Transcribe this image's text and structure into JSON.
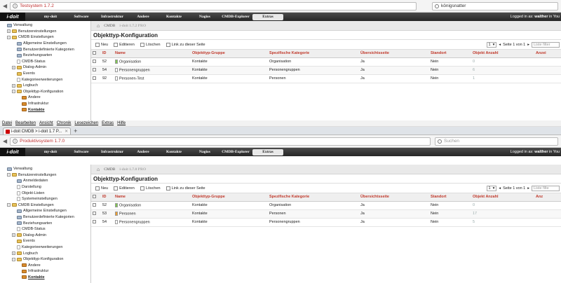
{
  "window1": {
    "url_title": "Testsystem 1.7.2",
    "search_value": "königsnatter",
    "logo": "i-doit",
    "nav": [
      "my-doit",
      "Software",
      "Infrastruktur",
      "Andere",
      "Kontakte",
      "Nagios",
      "CMDB-Explorer",
      "Extras"
    ],
    "logged_in": "Logged in as: ",
    "user": "walther",
    "user_suffix": " in You",
    "breadcrumb": [
      "CMDB",
      "i-doit 1.7.2 PRO"
    ],
    "page_title": "Objekttyp-Konfiguration",
    "toolbar": [
      "Neu",
      "Editieren",
      "Löschen",
      "Link zu dieser Seite"
    ],
    "pager": {
      "page_select": "1",
      "page_text": "Seite 1 von 1",
      "filter_placeholder": "Liste filter"
    },
    "columns": [
      "ID",
      "Name",
      "Objekttyp-Gruppe",
      "Spezifische Kategorie",
      "Übersichtsseite",
      "Standort",
      "Objekt Anzahl",
      "Anzei"
    ],
    "rows": [
      {
        "id": "52",
        "name": "Organisation",
        "color": "#7ec850",
        "group": "Kontakte",
        "cat": "Organisation",
        "overview": "Ja",
        "loc": "Nein",
        "count": "0"
      },
      {
        "id": "54",
        "name": "Personengruppen",
        "color": "#ffffff",
        "group": "Kontakte",
        "cat": "Personengruppen",
        "overview": "Ja",
        "loc": "Nein",
        "count": "6"
      },
      {
        "id": "92",
        "name": "Personen-Test",
        "color": "#ffffff",
        "group": "Kontakte",
        "cat": "Personen",
        "overview": "Ja",
        "loc": "Nein",
        "count": "1"
      }
    ],
    "tree": [
      {
        "label": "Verwaltung",
        "lvl": 0,
        "tog": "",
        "icon": "f-g"
      },
      {
        "label": "Benutzereinstellungen",
        "lvl": 1,
        "tog": "+",
        "icon": "f-y"
      },
      {
        "label": "CMDB Einstellungen",
        "lvl": 1,
        "tog": "−",
        "icon": "f-y"
      },
      {
        "label": "Allgemeine Einstellungen",
        "lvl": 2,
        "tog": "",
        "icon": "f-g"
      },
      {
        "label": "Benutzerdefinierte Kategorien",
        "lvl": 2,
        "tog": "",
        "icon": "f-g"
      },
      {
        "label": "Beziehungsarten",
        "lvl": 2,
        "tog": "",
        "icon": "f-g"
      },
      {
        "label": "CMDB-Status",
        "lvl": 2,
        "tog": "",
        "icon": "f-p"
      },
      {
        "label": "Dialog-Admin",
        "lvl": 2,
        "tog": "+",
        "icon": "f-y"
      },
      {
        "label": "Events",
        "lvl": 2,
        "tog": "",
        "icon": "f-y"
      },
      {
        "label": "Kategorieerweiterungen",
        "lvl": 2,
        "tog": "",
        "icon": "f-p"
      },
      {
        "label": "Logbuch",
        "lvl": 2,
        "tog": "+",
        "icon": "f-y"
      },
      {
        "label": "Objekttyp-Konfiguration",
        "lvl": 2,
        "tog": "−",
        "icon": "f-y"
      },
      {
        "label": "Andere",
        "lvl": 3,
        "tog": "",
        "icon": "f-o"
      },
      {
        "label": "Infrastruktur",
        "lvl": 3,
        "tog": "",
        "icon": "f-o"
      },
      {
        "label": "Kontakte",
        "lvl": 3,
        "tog": "",
        "icon": "f-o",
        "bold": true
      }
    ]
  },
  "window2": {
    "menu": [
      "Datei",
      "Bearbeiten",
      "Ansicht",
      "Chronik",
      "Lesezeichen",
      "Extras",
      "Hilfe"
    ],
    "tab_title": "i-doit CMDB > i-doit 1.7 P...",
    "url_title": "Produktivsystem 1.7.0",
    "search_placeholder": "Suchen",
    "logo": "i-doit",
    "nav": [
      "my-doit",
      "Software",
      "Infrastruktur",
      "Andere",
      "Kontakte",
      "Nagios",
      "CMDB-Explorer",
      "Extras"
    ],
    "logged_in": "Logged in as: ",
    "user": "walther",
    "user_suffix": " in You",
    "breadcrumb": [
      "CMDB",
      "i-doit 1.7.0 PRO"
    ],
    "page_title": "Objekttyp-Konfiguration",
    "toolbar": [
      "Neu",
      "Editieren",
      "Löschen",
      "Link zu dieser Seite"
    ],
    "pager": {
      "page_select": "1",
      "page_text": "Seite 1 von 1",
      "filter_placeholder": "Liste filte"
    },
    "columns": [
      "ID",
      "Name",
      "Objekttyp-Gruppe",
      "Spezifische Kategorie",
      "Übersichtsseite",
      "Standort",
      "Objekt Anzahl",
      "Anz"
    ],
    "rows": [
      {
        "id": "52",
        "name": "Organisation",
        "color": "#7ec850",
        "group": "Kontakte",
        "cat": "Organisation",
        "overview": "Ja",
        "loc": "Nein",
        "count": "0"
      },
      {
        "id": "53",
        "name": "Personen",
        "color": "#f0a030",
        "group": "Kontakte",
        "cat": "Personen",
        "overview": "Ja",
        "loc": "Nein",
        "count": "17"
      },
      {
        "id": "54",
        "name": "Personengruppen",
        "color": "#ffffff",
        "group": "Kontakte",
        "cat": "Personengruppen",
        "overview": "Ja",
        "loc": "Nein",
        "count": "5"
      }
    ],
    "tree": [
      {
        "label": "Verwaltung",
        "lvl": 0,
        "tog": "",
        "icon": "f-g"
      },
      {
        "label": "Benutzereinstellungen",
        "lvl": 1,
        "tog": "−",
        "icon": "f-y"
      },
      {
        "label": "Anmeldedaten",
        "lvl": 2,
        "tog": "",
        "icon": "f-g"
      },
      {
        "label": "Darstellung",
        "lvl": 2,
        "tog": "",
        "icon": "f-p"
      },
      {
        "label": "Objekt-Listen",
        "lvl": 2,
        "tog": "",
        "icon": "f-p"
      },
      {
        "label": "Systemeinstellungen",
        "lvl": 2,
        "tog": "",
        "icon": "f-p"
      },
      {
        "label": "CMDB Einstellungen",
        "lvl": 1,
        "tog": "−",
        "icon": "f-y"
      },
      {
        "label": "Allgemeine Einstellungen",
        "lvl": 2,
        "tog": "",
        "icon": "f-g"
      },
      {
        "label": "Benutzerdefinierte Kategorien",
        "lvl": 2,
        "tog": "",
        "icon": "f-g"
      },
      {
        "label": "Beziehungsarten",
        "lvl": 2,
        "tog": "",
        "icon": "f-g"
      },
      {
        "label": "CMDB-Status",
        "lvl": 2,
        "tog": "",
        "icon": "f-p"
      },
      {
        "label": "Dialog-Admin",
        "lvl": 2,
        "tog": "+",
        "icon": "f-y"
      },
      {
        "label": "Events",
        "lvl": 2,
        "tog": "",
        "icon": "f-y"
      },
      {
        "label": "Kategorieerweiterungen",
        "lvl": 2,
        "tog": "",
        "icon": "f-p"
      },
      {
        "label": "Logbuch",
        "lvl": 2,
        "tog": "+",
        "icon": "f-y"
      },
      {
        "label": "Objekttyp-Konfiguration",
        "lvl": 2,
        "tog": "−",
        "icon": "f-y"
      },
      {
        "label": "Andere",
        "lvl": 3,
        "tog": "",
        "icon": "f-o"
      },
      {
        "label": "Infrastruktur",
        "lvl": 3,
        "tog": "",
        "icon": "f-o"
      },
      {
        "label": "Kontakte",
        "lvl": 3,
        "tog": "",
        "icon": "f-o",
        "bold": true
      }
    ]
  }
}
